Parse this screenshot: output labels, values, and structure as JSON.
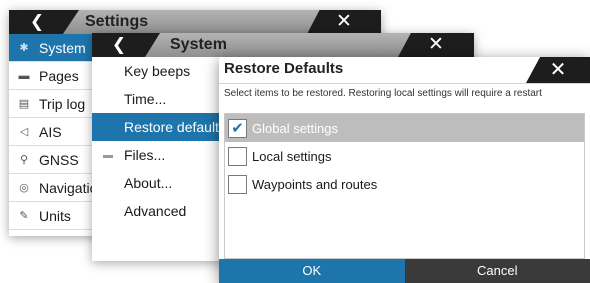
{
  "settings_panel": {
    "back_icon": "chevron-left",
    "title": "Settings",
    "close_icon": "x",
    "items": [
      {
        "label": "System",
        "icon": "gear",
        "selected": true
      },
      {
        "label": "Pages",
        "icon": "pages"
      },
      {
        "label": "Trip log",
        "icon": "trip-log"
      },
      {
        "label": "AIS",
        "icon": "ais"
      },
      {
        "label": "GNSS",
        "icon": "satellite"
      },
      {
        "label": "Navigation",
        "icon": "compass"
      },
      {
        "label": "Units",
        "icon": "pencil"
      }
    ]
  },
  "system_panel": {
    "back_icon": "chevron-left",
    "title": "System",
    "close_icon": "x",
    "items": [
      {
        "label": "Key beeps"
      },
      {
        "label": "Time..."
      },
      {
        "label": "Restore defaults...",
        "selected": true
      },
      {
        "label": "Files...",
        "icon": "files"
      },
      {
        "label": "About..."
      },
      {
        "label": "Advanced"
      }
    ]
  },
  "restore_dialog": {
    "title": "Restore Defaults",
    "close_icon": "x",
    "description": "Select items to be restored. Restoring local settings will require a restart",
    "options": [
      {
        "label": "Global settings",
        "checked": true
      },
      {
        "label": "Local settings",
        "checked": false
      },
      {
        "label": "Waypoints and routes",
        "checked": false
      }
    ],
    "ok_label": "OK",
    "cancel_label": "Cancel"
  },
  "colors": {
    "accent": "#1d75ab",
    "dark": "#1d1d1d",
    "titlebar_gray": "#a0a0a0",
    "option_selected": "#bdbdbd"
  }
}
